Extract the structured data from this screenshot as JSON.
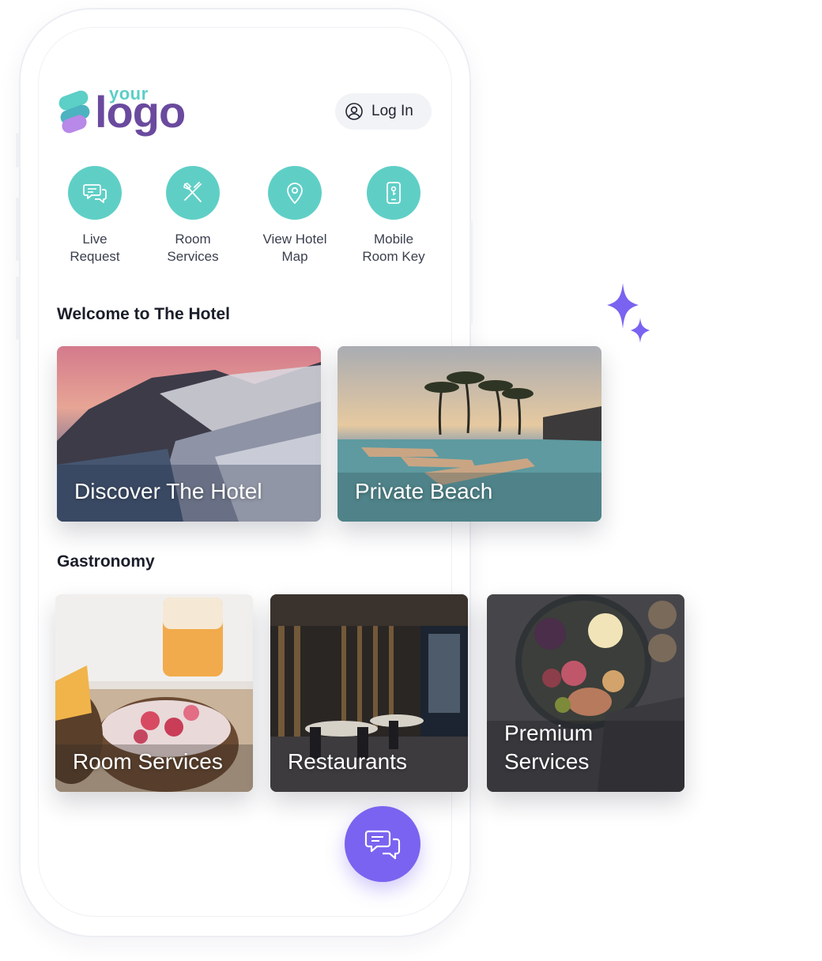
{
  "header": {
    "logo_small": "your",
    "logo_main": "logo",
    "login_label": "Log In"
  },
  "quick_actions": [
    {
      "label": "Live\nRequest",
      "icon": "chat-bubbles-icon"
    },
    {
      "label": "Room\nServices",
      "icon": "utensils-icon"
    },
    {
      "label": "View Hotel\nMap",
      "icon": "map-pin-icon"
    },
    {
      "label": "Mobile\nRoom Key",
      "icon": "phone-key-icon"
    }
  ],
  "welcome": {
    "title": "Welcome to The Hotel",
    "cards": [
      {
        "label": "Discover The Hotel"
      },
      {
        "label": "Private Beach"
      }
    ]
  },
  "gastronomy": {
    "title": "Gastronomy",
    "cards": [
      {
        "label": "Room Services"
      },
      {
        "label": "Restaurants"
      },
      {
        "label": "Premium\nServices"
      }
    ]
  },
  "colors": {
    "accent_teal": "#5fcfc6",
    "accent_purple": "#7a63f0",
    "logo_purple": "#6a4a9e"
  }
}
